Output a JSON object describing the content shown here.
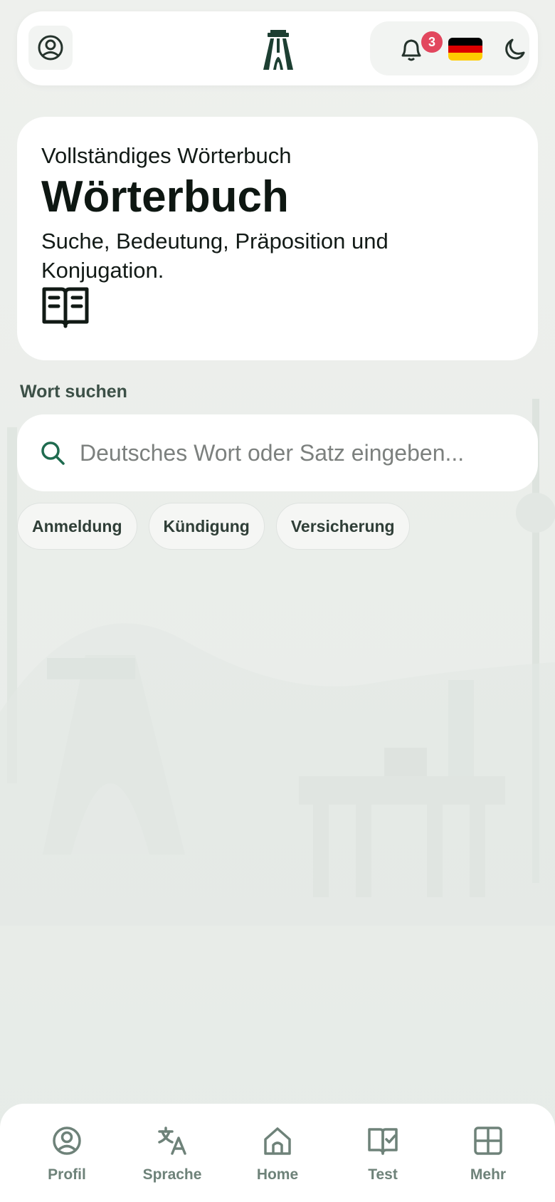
{
  "header": {
    "profile_icon": "user-circle-icon",
    "logo": "azadi-tower-logo",
    "notifications": {
      "icon": "bell-icon",
      "count": "3"
    },
    "language_flag": {
      "country": "Germany",
      "colors": [
        "#000000",
        "#dd0000",
        "#ffcc00"
      ]
    },
    "theme_icon": "moon-icon"
  },
  "hero": {
    "subtitle": "Vollständiges Wörterbuch",
    "title": "Wörterbuch",
    "description": "Suche, Bedeutung, Präposition und Konjugation.",
    "icon": "open-book-icon"
  },
  "search": {
    "label": "Wort suchen",
    "placeholder": "Deutsches Wort oder Satz eingeben...",
    "value": ""
  },
  "suggestions": [
    "Anmeldung",
    "Kündigung",
    "Versicherung"
  ],
  "bottom_nav": [
    {
      "label": "Profil",
      "icon": "user-circle-icon"
    },
    {
      "label": "Sprache",
      "icon": "translate-icon"
    },
    {
      "label": "Home",
      "icon": "home-icon"
    },
    {
      "label": "Test",
      "icon": "book-check-icon"
    },
    {
      "label": "Mehr",
      "icon": "grid-icon"
    }
  ],
  "colors": {
    "accent": "#1f6b4f",
    "badge": "#e2475e",
    "nav_text": "#6e8279"
  }
}
